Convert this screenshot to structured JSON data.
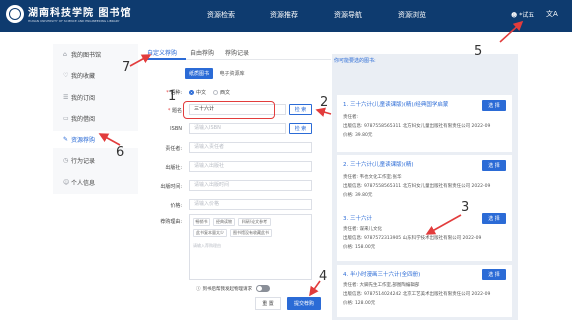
{
  "header": {
    "logo_text": "湖南科技学院 图书馆",
    "logo_sub": "HUNAN UNIVERSITY OF SCIENCE AND ENGINEERING LIBRARY",
    "nav": [
      "资源检索",
      "资源推荐",
      "资源导航",
      "资源浏览"
    ],
    "user": "*试五",
    "lang_icon": "文A"
  },
  "sidebar": {
    "items": [
      {
        "label": "我的图书馆",
        "icon": "home-icon",
        "glyph": "⌂"
      },
      {
        "label": "我的收藏",
        "icon": "heart-icon",
        "glyph": "♡"
      },
      {
        "label": "我的订阅",
        "icon": "rss-icon",
        "glyph": "☰"
      },
      {
        "label": "我的借阅",
        "icon": "book-icon",
        "glyph": "▭"
      },
      {
        "label": "资源荐购",
        "icon": "recommend-icon",
        "glyph": "✎"
      },
      {
        "label": "行为记录",
        "icon": "history-icon",
        "glyph": "◷"
      },
      {
        "label": "个人信息",
        "icon": "user-icon",
        "glyph": "☺"
      }
    ]
  },
  "tabs": [
    "自定义荐购",
    "自由荐购",
    "荐购记录"
  ],
  "subtabs": [
    "纸质图书",
    "电子资源库"
  ],
  "form": {
    "language_label": "语种:",
    "language_options": [
      "中文",
      "西文"
    ],
    "title_label": "题名",
    "title_value": "三十六计",
    "search_label": "检 索",
    "isbn_label": "ISBN",
    "isbn_placeholder": "请输入ISBN",
    "author_label": "责任者:",
    "author_placeholder": "请输入责任者",
    "publisher_label": "出版社:",
    "publisher_placeholder": "请输入出版社",
    "pubtime_label": "出版时间:",
    "pubtime_placeholder": "请输入出版时间",
    "price_label": "价格:",
    "price_placeholder": "请输入价格",
    "reason_label": "荐购理由:",
    "reason_chips": [
      "畅销书",
      "经典读物",
      "科研/论文参考",
      "此书复本量太少",
      "图书馆没有收藏此书"
    ],
    "reason_placeholder": "请输入荐购理由",
    "notice": "到书后帮我发起物理请求",
    "reset": "重 置",
    "submit": "提交荐购"
  },
  "results": {
    "title": "你可能要选的图书:",
    "select_label": "选 择",
    "books": [
      {
        "title": "1. 三十六计(儿童读课版)(精)/经典国学启蒙",
        "author": "责任者:",
        "publish": "出版信息: 9787558565311  北方妇女儿童出版社有限责任公司  2022-09",
        "price": "价格: 39.80元"
      },
      {
        "title": "2. 三十六计(儿童读课版)(精)",
        "author": "责任者: 韦也文化工作室;张华",
        "publish": "出版信息: 9787558565311  北方妇女儿童出版社有限责任公司  2022-09",
        "price": "价格: 39.80元"
      },
      {
        "title": "3. 三十六计",
        "author": "责任者: 谋来儿文化",
        "publish": "出版信息: 9787572313905  山东科学技术出版社有限公司  2022-09",
        "price": "价格: 158.00元"
      },
      {
        "title": "4. 半小时漫画三十六计(全四册)",
        "author": "责任者: 大脚先生工作室,部图陶编辑部",
        "publish": "出版信息: 9787514024242  北京工艺美术出版社有限责任公司  2022-09",
        "price": "价格: 128.00元"
      }
    ]
  },
  "annotations": [
    "1",
    "2",
    "3",
    "4",
    "5",
    "6",
    "7"
  ]
}
